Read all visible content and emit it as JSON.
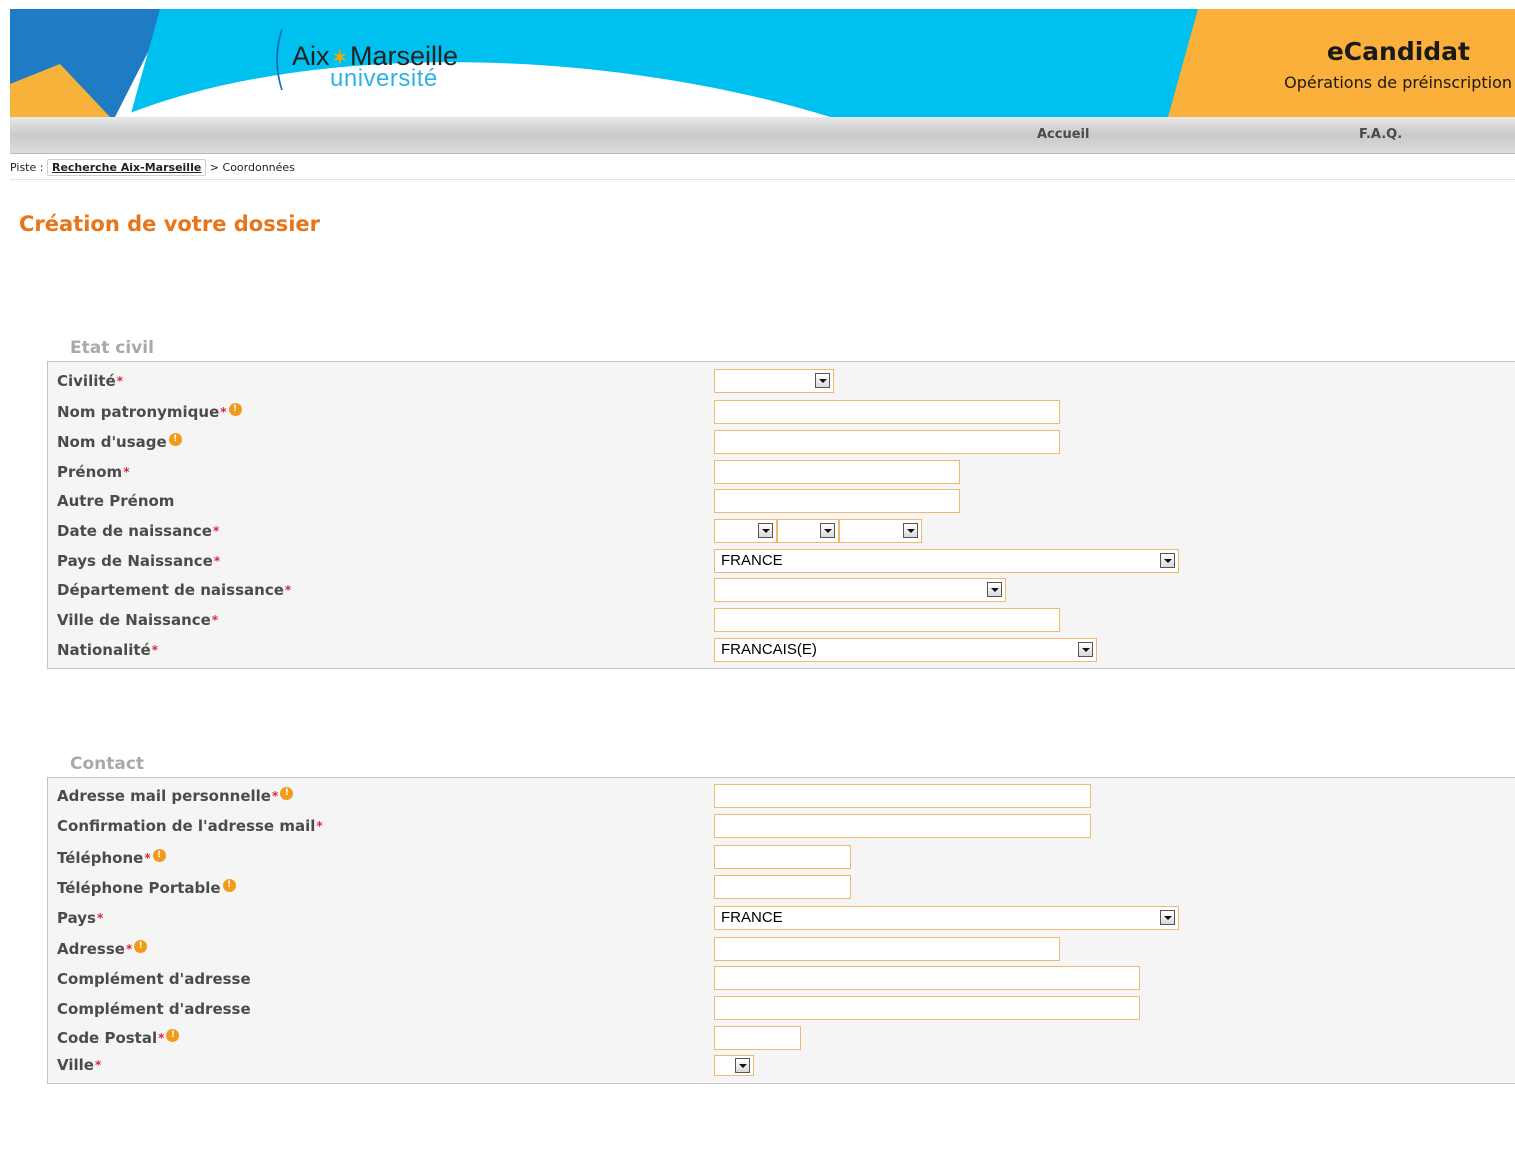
{
  "header": {
    "logo": {
      "line1_a": "Aix",
      "line1_b": "Marseille",
      "line2": "université"
    },
    "app_title": "eCandidat",
    "app_subtitle": "Opérations de préinscription"
  },
  "nav": {
    "accueil": "Accueil",
    "faq": "F.A.Q."
  },
  "breadcrumb": {
    "prefix": "Piste :",
    "link": "Recherche Aix-Marseille",
    "separator": "> ",
    "current": "Coordonnées"
  },
  "page_title": "Création de votre dossier",
  "etat_civil": {
    "legend": "Etat civil",
    "fields": {
      "civilite": {
        "label": "Civilité",
        "value": ""
      },
      "nom_patronymique": {
        "label": "Nom patronymique",
        "value": ""
      },
      "nom_usage": {
        "label": "Nom d'usage",
        "value": ""
      },
      "prenom": {
        "label": "Prénom",
        "value": ""
      },
      "autre_prenom": {
        "label": "Autre Prénom",
        "value": ""
      },
      "date_naissance": {
        "label": "Date de naissance",
        "day": "",
        "month": "",
        "year": ""
      },
      "pays_naissance": {
        "label": "Pays de Naissance",
        "value": "FRANCE"
      },
      "departement_naissance": {
        "label": "Département de naissance",
        "value": ""
      },
      "ville_naissance": {
        "label": "Ville de Naissance",
        "value": ""
      },
      "nationalite": {
        "label": "Nationalité",
        "value": "FRANCAIS(E)"
      }
    }
  },
  "contact": {
    "legend": "Contact",
    "fields": {
      "email": {
        "label": "Adresse mail personnelle",
        "value": ""
      },
      "email_confirm": {
        "label": "Confirmation de l'adresse mail",
        "value": ""
      },
      "telephone": {
        "label": "Téléphone",
        "value": ""
      },
      "telephone_portable": {
        "label": "Téléphone Portable",
        "value": ""
      },
      "pays": {
        "label": "Pays",
        "value": "FRANCE"
      },
      "adresse": {
        "label": "Adresse",
        "value": ""
      },
      "complement_1": {
        "label": "Complément d'adresse",
        "value": ""
      },
      "complement_2": {
        "label": "Complément d'adresse",
        "value": ""
      },
      "code_postal": {
        "label": "Code Postal",
        "value": ""
      },
      "ville": {
        "label": "Ville",
        "value": ""
      }
    }
  },
  "symbols": {
    "required": "*",
    "info": "!"
  },
  "colors": {
    "accent_orange": "#e8751a",
    "banner_blue": "#00c0ef",
    "banner_orange": "#fbb03b",
    "input_border": "#efb970",
    "required_mark": "#d9283c",
    "info_icon": "#f29a1a"
  }
}
